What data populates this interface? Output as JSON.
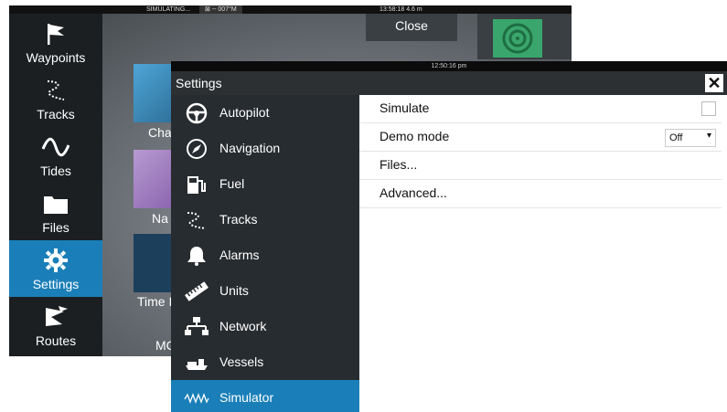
{
  "status_bar": {
    "left_text": "SIMULATING...",
    "mid_text": "⊠ -- 007°M",
    "right_text": "13:58:18  4.6 m"
  },
  "background": {
    "close_label": "Close",
    "sidebar_items": [
      {
        "label": "Waypoints",
        "icon": "flag-icon"
      },
      {
        "label": "Tracks",
        "icon": "track-icon"
      },
      {
        "label": "Tides",
        "icon": "wave-icon"
      },
      {
        "label": "Files",
        "icon": "folder-icon"
      },
      {
        "label": "Settings",
        "icon": "gear-icon"
      },
      {
        "label": "Routes",
        "icon": "route-flags-icon"
      }
    ],
    "app_labels": [
      "Cha",
      "Na",
      "Time I",
      "MC"
    ]
  },
  "settings": {
    "time": "12:50:16 pm",
    "title": "Settings",
    "close_glyph": "✕",
    "menu": [
      {
        "label": "Autopilot",
        "icon": "steering-wheel-icon"
      },
      {
        "label": "Navigation",
        "icon": "compass-icon"
      },
      {
        "label": "Fuel",
        "icon": "fuel-pump-icon"
      },
      {
        "label": "Tracks",
        "icon": "track-icon"
      },
      {
        "label": "Alarms",
        "icon": "bell-icon"
      },
      {
        "label": "Units",
        "icon": "ruler-icon"
      },
      {
        "label": "Network",
        "icon": "network-icon"
      },
      {
        "label": "Vessels",
        "icon": "vessel-icon"
      },
      {
        "label": "Simulator",
        "icon": "simulator-wave-icon"
      }
    ],
    "active_menu": "Simulator",
    "rows": {
      "simulate_label": "Simulate",
      "simulate_checked": false,
      "demo_mode_label": "Demo mode",
      "demo_mode_value": "Off",
      "files_label": "Files...",
      "advanced_label": "Advanced..."
    },
    "accent": "#1a7fb8"
  }
}
